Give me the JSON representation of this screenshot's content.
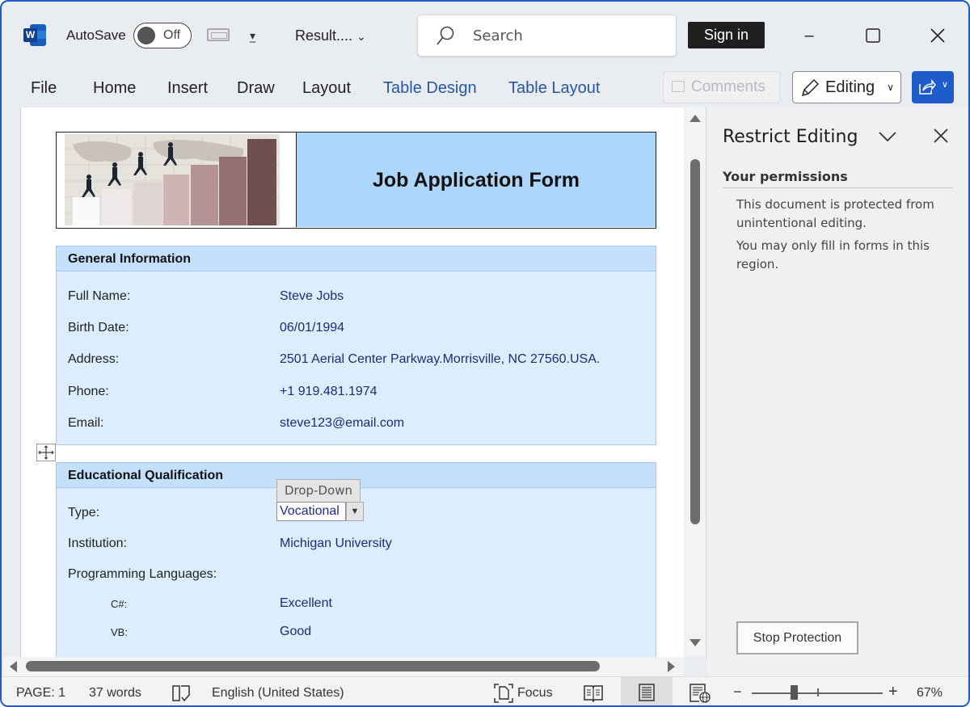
{
  "titlebar": {
    "autosave_label": "AutoSave",
    "autosave_state": "Off",
    "doc_title": "Result....",
    "search_placeholder": "Search",
    "signin_label": "Sign in",
    "minimize": "–",
    "maximize": "☐",
    "close": "✕"
  },
  "ribbon": {
    "tabs": [
      {
        "label": "File"
      },
      {
        "label": "Home"
      },
      {
        "label": "Insert"
      },
      {
        "label": "Draw"
      },
      {
        "label": "Layout"
      },
      {
        "label": "Table Design"
      },
      {
        "label": "Table Layout"
      }
    ],
    "comments_label": "Comments",
    "editing_label": "Editing"
  },
  "document": {
    "form_title": "Job Application Form",
    "general": {
      "heading": "General Information",
      "rows": [
        {
          "label": "Full Name:",
          "value": "Steve Jobs"
        },
        {
          "label": "Birth Date:",
          "value": "06/01/1994"
        },
        {
          "label": "Address:",
          "value": "2501 Aerial Center Parkway.Morrisville, NC 27560.USA."
        },
        {
          "label": "Phone:",
          "value": "+1 919.481.1974"
        },
        {
          "label": "Email:",
          "value": "steve123@email.com"
        }
      ]
    },
    "education": {
      "heading": "Educational Qualification",
      "type_label": "Type:",
      "type_tag": "Drop-Down",
      "type_value": "Vocational",
      "institution_label": "Institution:",
      "institution_value": "Michigan University",
      "languages_label": "Programming Languages:",
      "languages": [
        {
          "label": "C#:",
          "value": "Excellent"
        },
        {
          "label": "VB:",
          "value": "Good"
        }
      ]
    }
  },
  "pane": {
    "title": "Restrict Editing",
    "permissions_heading": "Your permissions",
    "text1": "This document is protected from unintentional editing.",
    "text2": "You may only fill in forms in this region.",
    "stop_button": "Stop Protection"
  },
  "statusbar": {
    "page": "PAGE: 1",
    "words": "37 words",
    "language": "English (United States)",
    "focus": "Focus",
    "zoom_percent": "67%",
    "zoom_minus": "−",
    "zoom_plus": "+"
  },
  "colors": {
    "accent": "#1e5ccc",
    "header_blue": "#add6fc",
    "section_bg": "#dcedfd",
    "value_text": "#1f2a7a"
  }
}
